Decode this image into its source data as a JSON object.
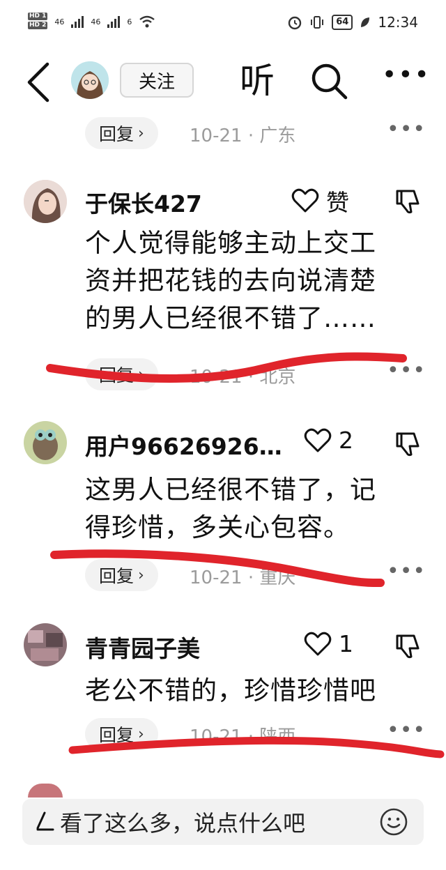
{
  "status_bar": {
    "sim1": "HD 1",
    "sim2": "HD 2",
    "net1": "46",
    "net2": "46",
    "net3": "6",
    "battery": "64",
    "time": "12:34",
    "icons": [
      "hd-icon",
      "signal-icon",
      "wifi-icon",
      "alarm-icon",
      "vibrate-icon",
      "battery-icon",
      "leaf-icon"
    ]
  },
  "nav": {
    "follow_label": "关注",
    "listen_label": "听",
    "more_label": "•••"
  },
  "prev_comment": {
    "reply_label": "回复",
    "meta": "10-21 · 广东"
  },
  "comments": [
    {
      "username": "于保长427",
      "like_label": "赞",
      "text_lines": [
        "个人觉得能够主动上交工",
        "资并把花钱的去向说清楚",
        "的男人已经很不错了……"
      ],
      "reply_label": "回复",
      "meta": "10-21 · 北京"
    },
    {
      "username": "用户96626926…",
      "like_label": "2",
      "text_lines": [
        "这男人已经很不错了，记",
        "得珍惜，多关心包容。"
      ],
      "reply_label": "回复",
      "meta": "10-21 · 重庆"
    },
    {
      "username": "青青园子美",
      "like_label": "1",
      "text_lines": [
        "老公不错的，珍惜珍惜吧"
      ],
      "reply_label": "回复",
      "meta": "10-21 · 陕西"
    }
  ],
  "input_bar": {
    "placeholder": "看了这么多，说点什么吧"
  },
  "colors": {
    "annotation_red": "#e0242b",
    "meta_gray": "#9b9b9b",
    "pill_bg": "#f2f2f2"
  }
}
